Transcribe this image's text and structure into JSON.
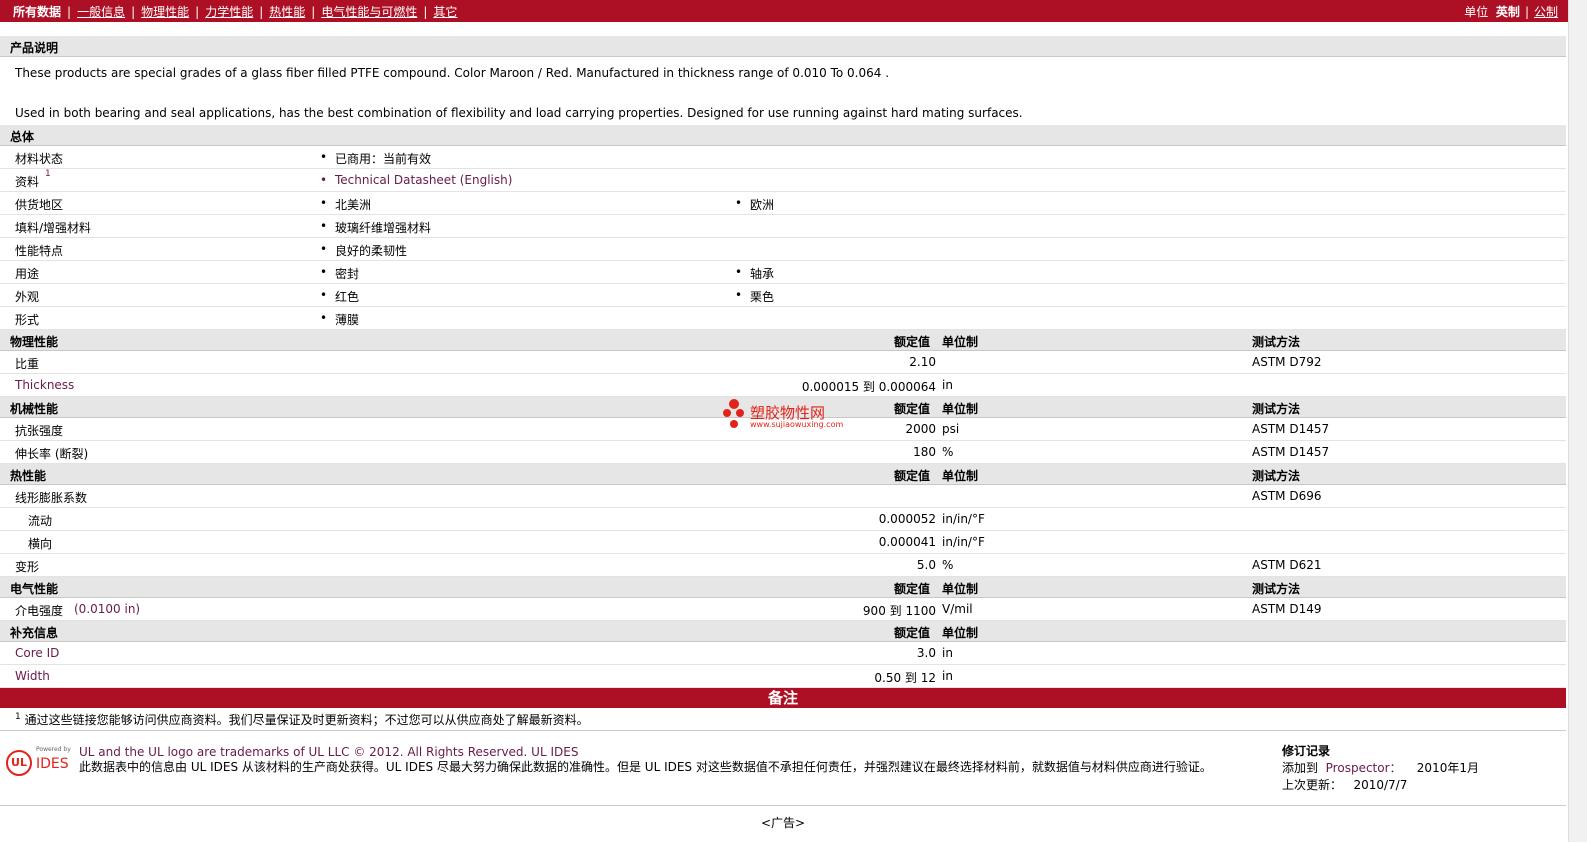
{
  "topnav": {
    "all_data": "所有数据",
    "items": [
      "一般信息",
      "物理性能",
      "力学性能",
      "热性能",
      "电气性能与可燃性",
      "其它"
    ],
    "units_label": "单位",
    "unit_english": "英制",
    "unit_metric": "公制"
  },
  "description": {
    "header": "产品说明",
    "p1": "These products are special grades of a glass fiber filled PTFE compound. Color Maroon / Red. Manufactured in thickness range of 0.010 To 0.064 .",
    "p2": "Used in both bearing and seal applications, has the best combination of flexibility and load carrying properties. Designed for use running against hard mating surfaces."
  },
  "general": {
    "header": "总体",
    "rows": [
      {
        "label": "材料状态",
        "v1": "已商用：当前有效",
        "v2": ""
      },
      {
        "label": "资料",
        "sup": "1",
        "v1": "Technical Datasheet (English)",
        "v2": ""
      },
      {
        "label": "供货地区",
        "v1": "北美洲",
        "v2": "欧洲"
      },
      {
        "label": "填料/增强材料",
        "v1": "玻璃纤维增强材料",
        "v2": ""
      },
      {
        "label": "性能特点",
        "v1": "良好的柔韧性",
        "v2": ""
      },
      {
        "label": "用途",
        "v1": "密封",
        "v2": "轴承"
      },
      {
        "label": "外观",
        "v1": "红色",
        "v2": "栗色"
      },
      {
        "label": "形式",
        "v1": "薄膜",
        "v2": ""
      }
    ]
  },
  "columns": {
    "nominal": "额定值",
    "unit": "单位制",
    "method": "测试方法"
  },
  "physical": {
    "header": "物理性能",
    "rows": [
      {
        "label": "比重",
        "value": "2.10",
        "unit": "",
        "method": "ASTM D792"
      },
      {
        "label": "Thickness",
        "value": "0.000015 到  0.000064",
        "unit": "in",
        "method": ""
      }
    ]
  },
  "mechanical": {
    "header": "机械性能",
    "rows": [
      {
        "label": "抗张强度",
        "value": "2000",
        "unit": "psi",
        "method": "ASTM D1457"
      },
      {
        "label": "伸长率 (断裂)",
        "value": "180",
        "unit": "%",
        "method": "ASTM D1457"
      }
    ]
  },
  "thermal": {
    "header": "热性能",
    "rows": [
      {
        "label": "线形膨胀系数",
        "value": "",
        "unit": "",
        "method": "ASTM D696"
      },
      {
        "label": "流动",
        "value": "0.000052",
        "unit": "in/in/°F",
        "method": ""
      },
      {
        "label": "横向",
        "value": "0.000041",
        "unit": "in/in/°F",
        "method": ""
      },
      {
        "label": "变形",
        "value": "5.0",
        "unit": "%",
        "method": "ASTM D621"
      }
    ]
  },
  "electrical": {
    "header": "电气性能",
    "rows": [
      {
        "label": "介电强度",
        "cond": "(0.0100 in)",
        "value": "900 到  1100",
        "unit": "V/mil",
        "method": "ASTM D149"
      }
    ]
  },
  "supplement": {
    "header": "补充信息",
    "rows": [
      {
        "label": "Core ID",
        "value": "3.0",
        "unit": "in"
      },
      {
        "label": "Width",
        "value": "0.50 到  12",
        "unit": "in"
      }
    ]
  },
  "notes": {
    "header": "备注",
    "sup": "1",
    "text": "通过这些链接您能够访问供应商资料。我们尽量保证及时更新资料；不过您可以从供应商处了解最新资料。"
  },
  "watermark": {
    "title": "塑胶物性网",
    "url": "www.sujiaowuxing.com"
  },
  "footer": {
    "powered_by": "Powered by",
    "logo_ul": "UL",
    "logo_ides": "IDES",
    "line1": "UL and the UL logo are trademarks of UL LLC © 2012. All Rights Reserved. UL IDES",
    "line2": "此数据表中的信息由  UL IDES 从该材料的生产商处获得。UL IDES 尽最大努力确保此数据的准确性。但是  UL IDES 对这些数据值不承担任何责任，并强烈建议在最终选择材料前，就数据值与材料供应商进行验证。",
    "rev_title": "修订记录",
    "added_label": "添加到",
    "added_link": "Prospector：",
    "added_date": "2010年1月",
    "updated_label": "上次更新：",
    "updated_date": "2010/7/7"
  },
  "ad": "<广告>"
}
